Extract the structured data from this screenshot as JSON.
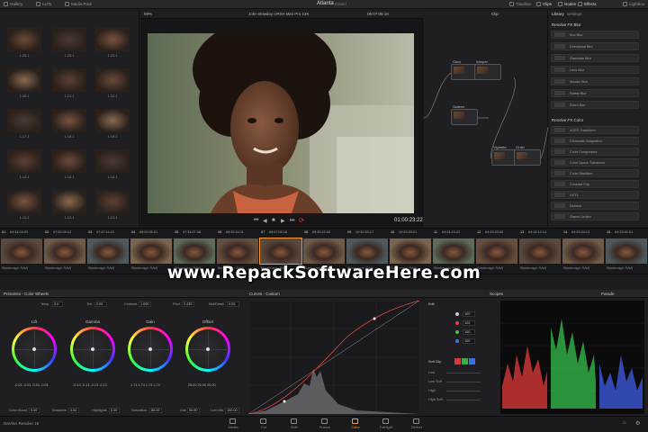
{
  "topbar": {
    "gallery": "Gallery",
    "luts": "LUTs",
    "media_pool": "Media Pool",
    "project_title": "Atlanta",
    "edited": "Edited",
    "timeline": "Timeline",
    "clips": "Clips",
    "nodes": "Nodes",
    "effects": "Effects",
    "lightbox": "Lightbox"
  },
  "gallery": {
    "stills": [
      "1.25.1",
      "1.26.1",
      "1.24.1",
      "1.20.1",
      "1.21.1",
      "1.22.1",
      "1.17.1",
      "1.18.1",
      "1.19.1",
      "1.14.1",
      "1.15.1",
      "1.16.1",
      "1.11.1",
      "1.12.1",
      "1.13.1"
    ]
  },
  "viewer": {
    "zoom": "59%",
    "clip_name": "John Brawley URSA Mini Pro 12K",
    "source_tc": "06:07:05:16",
    "clip_dropdown": "Clip",
    "timecode": "01:00:23:22"
  },
  "nodes": {
    "labels": [
      "Glow",
      "Warper",
      "Saliene",
      "Vignette",
      "Grain"
    ]
  },
  "library": {
    "tab_library": "Library",
    "tab_settings": "Settings",
    "section_blur": "Resolve FX Blur",
    "blur_items": [
      "Box Blur",
      "Directional Blur",
      "Gaussian Blur",
      "Lens Blur",
      "Mosaic Blur",
      "Radial Blur",
      "Zoom Blur"
    ],
    "section_color": "Resolve FX Color",
    "color_items": [
      "ACES Transform",
      "Chromatic Adaptation",
      "Color Compressor",
      "Color Space Transform",
      "Color Stabilizer",
      "Contrast Pop",
      "DCTL",
      "Dehaze",
      "Gamut Limiter"
    ]
  },
  "timeline": {
    "clips": [
      {
        "num": "01",
        "tc": "04:34:04:05",
        "label": "Blackmagic RAW"
      },
      {
        "num": "02",
        "tc": "07:02:09:12",
        "label": "Blackmagic RAW"
      },
      {
        "num": "03",
        "tc": "07:47:11:13",
        "label": "Blackmagic RAW"
      },
      {
        "num": "04",
        "tc": "06:09:35:01",
        "label": "Blackmagic RAW"
      },
      {
        "num": "05",
        "tc": "07:34:07:08",
        "label": "Blackmagic RAW"
      },
      {
        "num": "06",
        "tc": "06:29:11:01",
        "label": "Blackmagic RAW"
      },
      {
        "num": "07",
        "tc": "06:07:05:16",
        "label": "Blackmagic RAW"
      },
      {
        "num": "08",
        "tc": "05:33:22:00",
        "label": "Blackmagic RAW"
      },
      {
        "num": "09",
        "tc": "10:32:33:17",
        "label": "Blackmagic RAW"
      },
      {
        "num": "10",
        "tc": "10:25:39:21",
        "label": "Blackmagic RAW"
      },
      {
        "num": "11",
        "tc": "04:24:23:22",
        "label": "Blackmagic RAW"
      },
      {
        "num": "12",
        "tc": "04:25:33:06",
        "label": "Blackmagic RAW"
      },
      {
        "num": "13",
        "tc": "04:18:12:14",
        "label": "Blackmagic RAW"
      },
      {
        "num": "14",
        "tc": "04:25:34:13",
        "label": "Blackmagic RAW"
      },
      {
        "num": "15",
        "tc": "04:23:52:01",
        "label": "Blackmagic RAW"
      }
    ]
  },
  "watermark": "www.RepackSoftwareHere.com",
  "primaries": {
    "title": "Primaries - Color Wheels",
    "temp_label": "Temp",
    "temp": "0.0",
    "tint_label": "Tint",
    "tint": "0.00",
    "contrast_label": "Contrast",
    "contrast": "1.000",
    "pivot_label": "Pivot",
    "pivot": "0.435",
    "middetail_label": "Mid/Detail",
    "middetail": "0.00",
    "wheels": [
      {
        "name": "Lift",
        "values": "-0.01  -0.01  -0.01  -0.01"
      },
      {
        "name": "Gamma",
        "values": "-0.13  -0.13  -0.13  -0.13"
      },
      {
        "name": "Gain",
        "values": "1.74  1.74  1.74  1.74"
      },
      {
        "name": "Offset",
        "values": "25.00  25.00  25.00"
      }
    ],
    "colorboost_label": "Color Boost",
    "colorboost": "0.00",
    "shadows_label": "Shadows",
    "shadows": "0.00",
    "highlights_label": "Highlights",
    "highlights": "0.00",
    "saturation_label": "Saturation",
    "saturation": "50.00",
    "hue_label": "Hue",
    "hue": "50.00",
    "lummix_label": "Lum Mix",
    "lummix": "100.00"
  },
  "curves": {
    "title": "Curves - Custom",
    "edit": "Edit",
    "channel_values": [
      "100",
      "100",
      "100",
      "100"
    ],
    "softclip": "Soft Clip",
    "softclip_rows": [
      "Low",
      "Low Soft",
      "High",
      "High Soft"
    ]
  },
  "scopes": {
    "title": "Scopes",
    "mode": "Parade"
  },
  "pages": {
    "app": "DaVinci Resolve 18",
    "items": [
      "Media",
      "Cut",
      "Edit",
      "Fusion",
      "Color",
      "Fairlight",
      "Deliver"
    ],
    "active": "Color"
  },
  "colors": {
    "accent": "#ff9a3c",
    "bg": "#1f1f22"
  }
}
